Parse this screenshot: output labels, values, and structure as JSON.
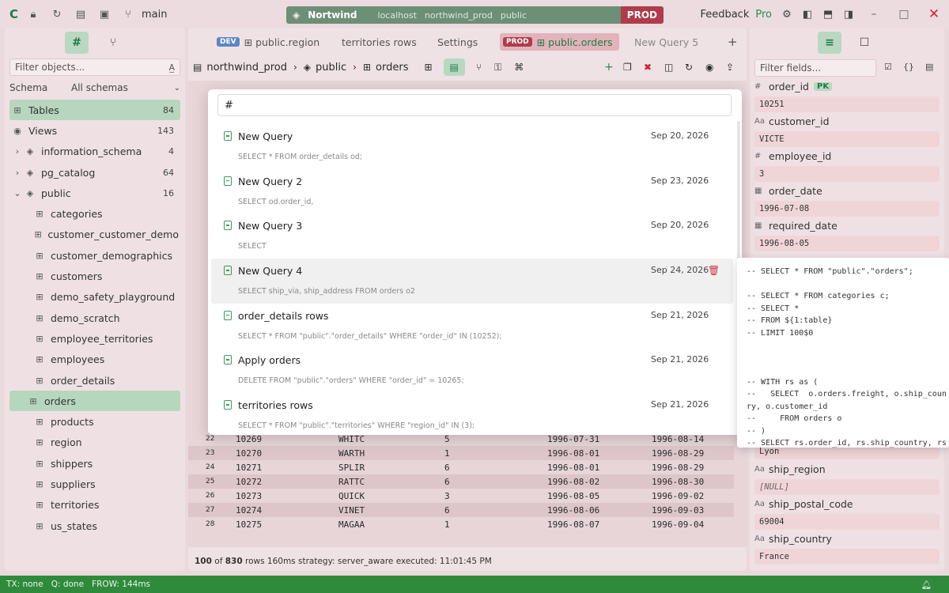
{
  "titlebar": {
    "branch": "main",
    "connection_name": "Nortwind",
    "crumbs": [
      "localhost",
      "northwind_prod",
      "public"
    ],
    "env": "PROD",
    "feedback": "Feedback",
    "pro": "Pro"
  },
  "sidebar": {
    "filter_placeholder": "Filter objects...",
    "schema_label": "Schema",
    "schema_value": "All schemas",
    "rows": [
      {
        "label": "Tables",
        "count": "84",
        "icon": "table-icon"
      },
      {
        "label": "Views",
        "count": "143",
        "icon": "eye-icon"
      },
      {
        "label": "information_schema",
        "count": "4",
        "icon": "layers-icon"
      },
      {
        "label": "pg_catalog",
        "count": "64",
        "icon": "layers-icon"
      },
      {
        "label": "public",
        "count": "16",
        "icon": "layers-icon"
      }
    ],
    "tables": [
      "categories",
      "customer_customer_demo",
      "customer_demographics",
      "customers",
      "demo_safety_playground",
      "demo_scratch",
      "employee_territories",
      "employees",
      "order_details",
      "orders",
      "products",
      "region",
      "shippers",
      "suppliers",
      "territories",
      "us_states"
    ]
  },
  "center": {
    "tabs": [
      {
        "label": "public.region",
        "badge": "DEV"
      },
      {
        "label": "territories rows",
        "badge": ""
      },
      {
        "label": "Settings",
        "badge": ""
      },
      {
        "label": "public.orders",
        "badge": "PROD"
      },
      {
        "label": "New Query 5",
        "badge": ""
      }
    ],
    "breadcrumb": [
      "northwind_prod",
      "public",
      "orders"
    ],
    "grid_rows": [
      {
        "n": "22",
        "id": "10269",
        "cust": "WHITC",
        "emp": "5",
        "od": "1996-07-31",
        "rd": "1996-08-14"
      },
      {
        "n": "23",
        "id": "10270",
        "cust": "WARTH",
        "emp": "1",
        "od": "1996-08-01",
        "rd": "1996-08-29"
      },
      {
        "n": "24",
        "id": "10271",
        "cust": "SPLIR",
        "emp": "6",
        "od": "1996-08-01",
        "rd": "1996-08-29"
      },
      {
        "n": "25",
        "id": "10272",
        "cust": "RATTC",
        "emp": "6",
        "od": "1996-08-02",
        "rd": "1996-08-30"
      },
      {
        "n": "26",
        "id": "10273",
        "cust": "QUICK",
        "emp": "3",
        "od": "1996-08-05",
        "rd": "1996-09-02"
      },
      {
        "n": "27",
        "id": "10274",
        "cust": "VINET",
        "emp": "6",
        "od": "1996-08-06",
        "rd": "1996-09-03"
      },
      {
        "n": "28",
        "id": "10275",
        "cust": "MAGAA",
        "emp": "1",
        "od": "1996-08-07",
        "rd": "1996-09-04"
      }
    ],
    "status": {
      "shown": "100",
      "of_label": "of",
      "total": "830",
      "rest": "rows 160ms  strategy: server_aware  executed: 11:01:45 PM"
    }
  },
  "rpanel": {
    "filter_placeholder": "Filter fields...",
    "fields": [
      {
        "name": "order_id",
        "value": "10251",
        "pk": "PK",
        "icon": "hash-icon"
      },
      {
        "name": "customer_id",
        "value": "VICTE",
        "pk": "",
        "icon": "text-icon"
      },
      {
        "name": "employee_id",
        "value": "3",
        "pk": "",
        "icon": "hash-icon"
      },
      {
        "name": "order_date",
        "value": "1996-07-08",
        "pk": "",
        "icon": "calendar-icon"
      },
      {
        "name": "required_date",
        "value": "1996-08-05",
        "pk": "",
        "icon": "calendar-icon"
      }
    ],
    "lower_value_0": "Lyon",
    "lower_fields": [
      {
        "name": "ship_region",
        "value": "[NULL]"
      },
      {
        "name": "ship_postal_code",
        "value": "69004"
      },
      {
        "name": "ship_country",
        "value": "France"
      }
    ]
  },
  "palette": {
    "query": "#",
    "items": [
      {
        "title": "New Query",
        "sub": "SELECT * FROM order_details od;",
        "date": "Sep 20, 2026"
      },
      {
        "title": "New Query 2",
        "sub": "SELECT od.order_id,",
        "date": "Sep 23, 2026"
      },
      {
        "title": "New Query 3",
        "sub": "SELECT",
        "date": "Sep 20, 2026"
      },
      {
        "title": "New Query 4",
        "sub": "SELECT ship_via, ship_address FROM orders o2",
        "date": "Sep 24, 2026"
      },
      {
        "title": "order_details rows",
        "sub": "SELECT * FROM \"public\".\"order_details\" WHERE \"order_id\" IN (10252);",
        "date": "Sep 21, 2026"
      },
      {
        "title": "Apply orders",
        "sub": "DELETE FROM \"public\".\"orders\" WHERE \"order_id\" = 10265;",
        "date": "Sep 21, 2026"
      },
      {
        "title": "territories rows",
        "sub": "SELECT * FROM \"public\".\"territories\" WHERE \"region_id\" IN (3);",
        "date": "Sep 21, 2026"
      }
    ]
  },
  "preview": {
    "text": "-- SELECT * FROM \"public\".\"orders\";\n\n-- SELECT * FROM categories c;\n-- SELECT *\n-- FROM ${1:table}\n-- LIMIT 100$0\n\n\n\n-- WITH rs as (\n--   SELECT  o.orders.freight, o.ship_coun\nry, o.customer_id\n--     FROM orders o\n-- )\n-- SELECT rs.order_id, rs.ship_country, rs"
  },
  "footer": {
    "tx": "TX: none",
    "q": "Q: done",
    "frow": "FROW: 144ms"
  }
}
